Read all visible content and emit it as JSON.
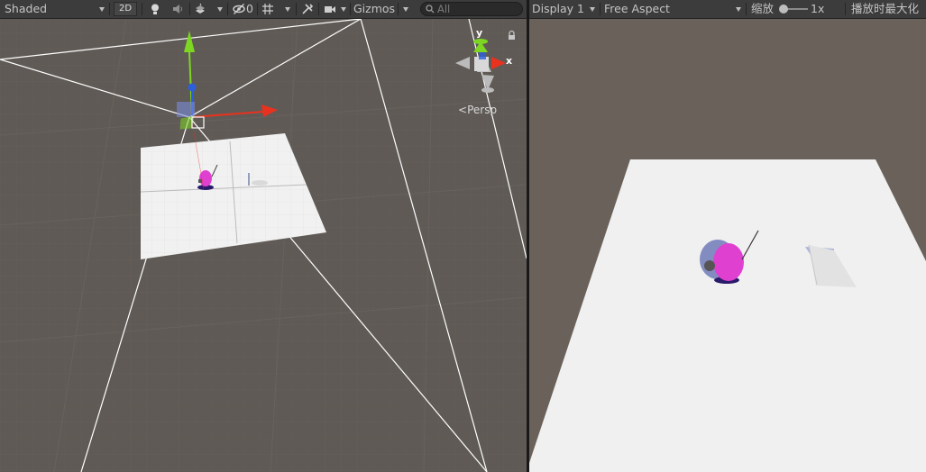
{
  "scene_toolbar": {
    "draw_mode": "Shaded",
    "mode_2d": "2D",
    "hidden_count": "0",
    "gizmos": "Gizmos",
    "search_placeholder": "All"
  },
  "game_toolbar": {
    "display": "Display 1",
    "aspect": "Free Aspect",
    "scale_label": "缩放",
    "scale_value": "1x",
    "maximize": "播放时最大化"
  },
  "scene_view": {
    "projection": "Persp",
    "gizmo_x": "x",
    "gizmo_y": "y"
  },
  "icons": [
    "lighting-icon",
    "audio-icon",
    "effects-icon",
    "hidden-objects-icon",
    "grid-icon",
    "tools-icon",
    "camera-icon",
    "search-icon",
    "lock-icon"
  ],
  "colors": {
    "scene_bg": "#5f5a55",
    "game_bg": "#6a625a",
    "toolbar_bg": "#3c3c3c",
    "character": "#e040d0",
    "axis_x": "#e8321f",
    "axis_y": "#7dd622",
    "axis_z": "#2d5fdc"
  }
}
